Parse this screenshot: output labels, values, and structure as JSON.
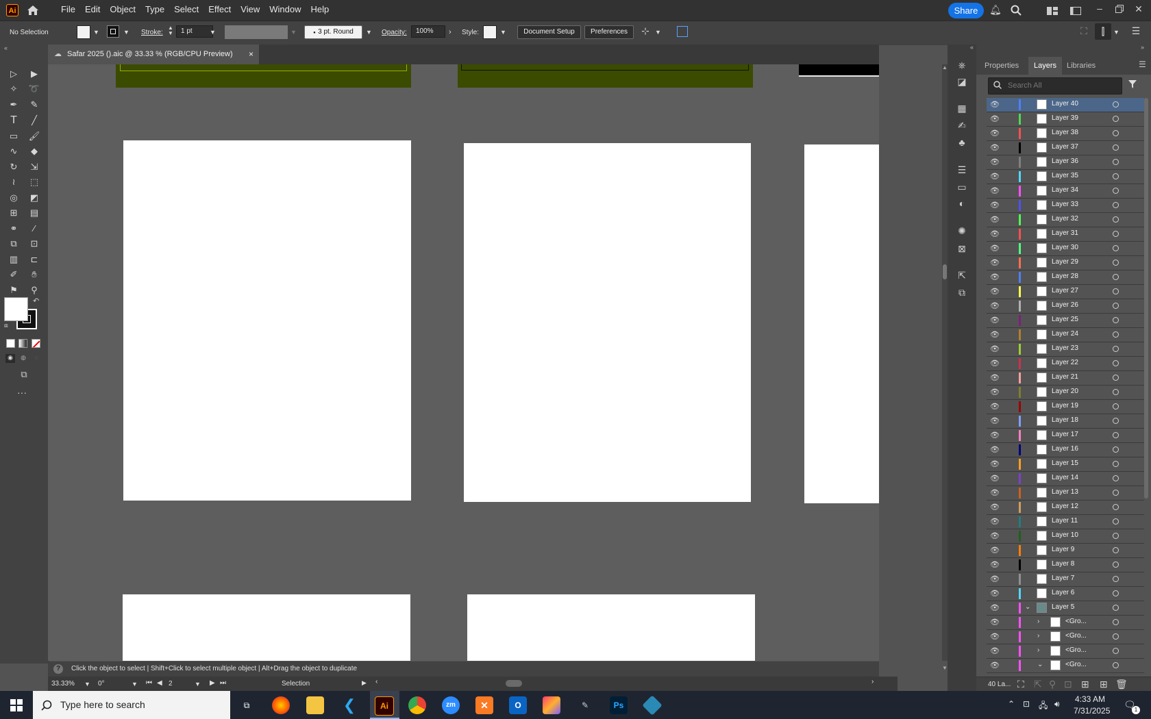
{
  "menubar": {
    "logo": "Ai",
    "items": [
      "File",
      "Edit",
      "Object",
      "Type",
      "Select",
      "Effect",
      "View",
      "Window",
      "Help"
    ],
    "share_label": "Share"
  },
  "controlbar": {
    "selection_status": "No Selection",
    "stroke_label": "Stroke:",
    "stroke_weight": "1 pt",
    "brush_profile": "3 pt. Round",
    "opacity_label": "Opacity:",
    "opacity_value": "100%",
    "style_label": "Style:",
    "document_setup": "Document Setup",
    "preferences": "Preferences"
  },
  "document_tab": {
    "title": "Safar 2025 ().aic @ 33.33 % (RGB/CPU Preview)",
    "close": "×"
  },
  "statusbar": {
    "hint_icon": "?",
    "hint_text": "Click the object to select  |  Shift+Click to select multiple object  |  Alt+Drag the object to duplicate"
  },
  "bottombar": {
    "zoom": "33.33%",
    "rotation": "0°",
    "artboard_number": "2",
    "tool_name": "Selection"
  },
  "panel": {
    "tabs": [
      "Properties",
      "Layers",
      "Libraries"
    ],
    "active_tab": "Layers",
    "search_placeholder": "Search All",
    "footer_count": "40 La..."
  },
  "layers": [
    {
      "name": "Layer 40",
      "color": "#4f7fff",
      "selected": true
    },
    {
      "name": "Layer 39",
      "color": "#4fd94f"
    },
    {
      "name": "Layer 38",
      "color": "#ff4f4f"
    },
    {
      "name": "Layer 37",
      "color": "#000000"
    },
    {
      "name": "Layer 36",
      "color": "#808080"
    },
    {
      "name": "Layer 35",
      "color": "#4fd9ff"
    },
    {
      "name": "Layer 34",
      "color": "#ff4fff"
    },
    {
      "name": "Layer 33",
      "color": "#4f4fff"
    },
    {
      "name": "Layer 32",
      "color": "#4fff4f"
    },
    {
      "name": "Layer 31",
      "color": "#ff4f4f"
    },
    {
      "name": "Layer 30",
      "color": "#4fff7f"
    },
    {
      "name": "Layer 29",
      "color": "#ff6f4f"
    },
    {
      "name": "Layer 28",
      "color": "#4f7fff"
    },
    {
      "name": "Layer 27",
      "color": "#ffff4f"
    },
    {
      "name": "Layer 26",
      "color": "#b0b0b0"
    },
    {
      "name": "Layer 25",
      "color": "#7f1f7f"
    },
    {
      "name": "Layer 24",
      "color": "#b07f2f"
    },
    {
      "name": "Layer 23",
      "color": "#9fcf2f"
    },
    {
      "name": "Layer 22",
      "color": "#cf2f4f"
    },
    {
      "name": "Layer 21",
      "color": "#ff9f9f"
    },
    {
      "name": "Layer 20",
      "color": "#7f7f2f"
    },
    {
      "name": "Layer 19",
      "color": "#9f0000"
    },
    {
      "name": "Layer 18",
      "color": "#7f9fff"
    },
    {
      "name": "Layer 17",
      "color": "#ff7fbf"
    },
    {
      "name": "Layer 16",
      "color": "#00007f"
    },
    {
      "name": "Layer 15",
      "color": "#ff9f1f"
    },
    {
      "name": "Layer 14",
      "color": "#7f3fcf"
    },
    {
      "name": "Layer 13",
      "color": "#cf5f1f"
    },
    {
      "name": "Layer 12",
      "color": "#cf9f5f"
    },
    {
      "name": "Layer 11",
      "color": "#1f7f7f"
    },
    {
      "name": "Layer 10",
      "color": "#1f5f1f"
    },
    {
      "name": "Layer 9",
      "color": "#ff7f00"
    },
    {
      "name": "Layer 8",
      "color": "#000000"
    },
    {
      "name": "Layer 7",
      "color": "#909090"
    },
    {
      "name": "Layer 6",
      "color": "#4fd9ff"
    },
    {
      "name": "Layer 5",
      "color": "#ff4fff",
      "expanded": true
    },
    {
      "name": "<Gro...",
      "color": "#ff4fff",
      "sublayer": true,
      "expanded": false
    },
    {
      "name": "<Gro...",
      "color": "#ff4fff",
      "sublayer": true,
      "expanded": false
    },
    {
      "name": "<Gro...",
      "color": "#ff4fff",
      "sublayer": true,
      "expanded": false
    },
    {
      "name": "<Gro...",
      "color": "#ff4fff",
      "sublayer": true,
      "expanded": true
    }
  ],
  "taskbar": {
    "search_placeholder": "Type here to search",
    "time": "4:33 AM",
    "date": "7/31/2025",
    "notification_count": "1",
    "apps": [
      "task-view",
      "firefox",
      "file-explorer",
      "vscode",
      "illustrator",
      "chrome",
      "zoom",
      "xampp",
      "outlook",
      "creative-cloud",
      "pen-tool-app",
      "photoshop",
      "virtualbox"
    ]
  },
  "colors": {
    "accent": "#1473e6",
    "fill_swatch": "#ffffff",
    "stroke_swatch": "#000000",
    "artboard_green": "#3b4b00"
  }
}
